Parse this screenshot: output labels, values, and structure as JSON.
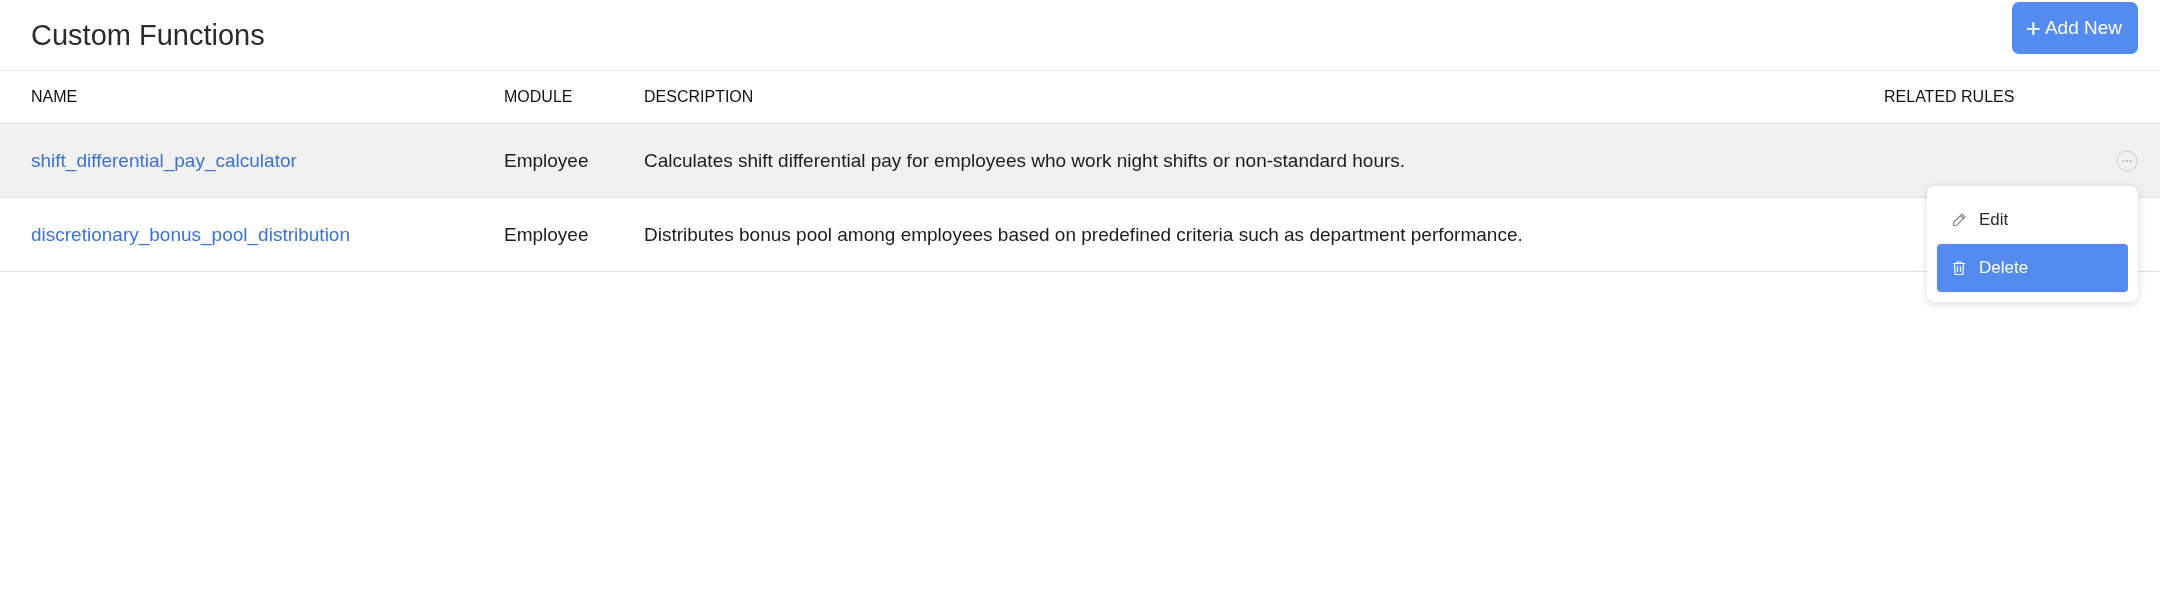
{
  "page": {
    "title": "Custom Functions",
    "add_button": {
      "icon": "+",
      "label": "Add New"
    }
  },
  "table": {
    "columns": [
      "NAME",
      "MODULE",
      "DESCRIPTION",
      "RELATED RULES"
    ],
    "rows": [
      {
        "name": "shift_differential_pay_calculator",
        "module": "Employee",
        "description": "Calculates shift differential pay for employees who work night shifts or non-standard hours.",
        "highlighted": true,
        "menu_open": true
      },
      {
        "name": "discretionary_bonus_pool_distribution",
        "module": "Employee",
        "description": "Distributes bonus pool among employees based on predefined criteria such as department performance.",
        "highlighted": false,
        "menu_open": false
      }
    ]
  },
  "row_menu": {
    "items": [
      {
        "kind": "edit",
        "label": "Edit",
        "selected": false
      },
      {
        "kind": "delete",
        "label": "Delete",
        "selected": true
      }
    ]
  }
}
